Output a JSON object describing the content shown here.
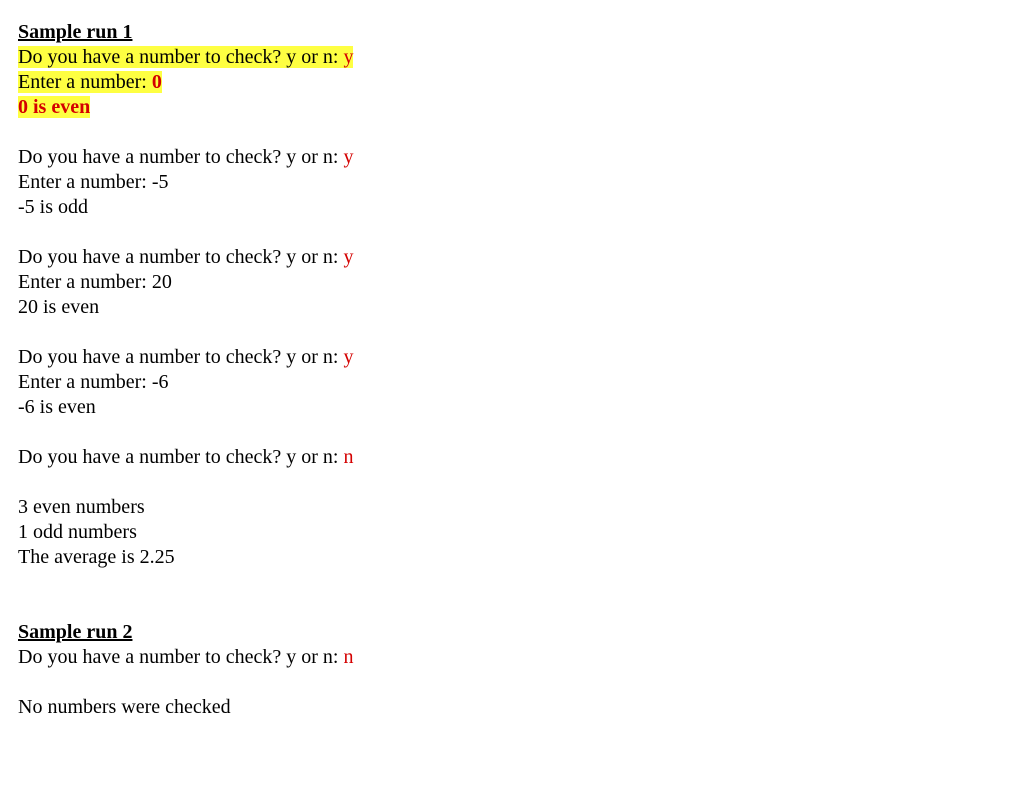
{
  "run1": {
    "title": "Sample run 1",
    "blocks": [
      {
        "highlight": true,
        "prompt_prefix": "Do you have a number to check? y or n: ",
        "prompt_answer": "y",
        "enter_prefix": "Enter a number: ",
        "enter_value": "0",
        "enter_value_red": true,
        "result": "0 is even",
        "result_red": true
      },
      {
        "highlight": false,
        "prompt_prefix": "Do you have a number to check? y or n: ",
        "prompt_answer": "y",
        "enter_prefix": "Enter a number: ",
        "enter_value": "-5",
        "enter_value_red": false,
        "result": "-5 is odd",
        "result_red": false
      },
      {
        "highlight": false,
        "prompt_prefix": "Do you have a number to check? y or n: ",
        "prompt_answer": "y",
        "enter_prefix": "Enter a number: ",
        "enter_value": "20",
        "enter_value_red": false,
        "result": "20 is even",
        "result_red": false
      },
      {
        "highlight": false,
        "prompt_prefix": "Do you have a number to check? y or n: ",
        "prompt_answer": "y",
        "enter_prefix": "Enter a number: ",
        "enter_value": "-6",
        "enter_value_red": false,
        "result": "-6 is even",
        "result_red": false
      }
    ],
    "final_prompt_prefix": "Do you have a number to check? y or n: ",
    "final_prompt_answer": "n",
    "summary": {
      "even": "3 even numbers",
      "odd": "1 odd numbers",
      "avg": "The average is 2.25"
    }
  },
  "run2": {
    "title": "Sample run 2",
    "prompt_prefix": "Do you have a number to check? y or n: ",
    "prompt_answer": "n",
    "result": "No numbers were checked"
  }
}
